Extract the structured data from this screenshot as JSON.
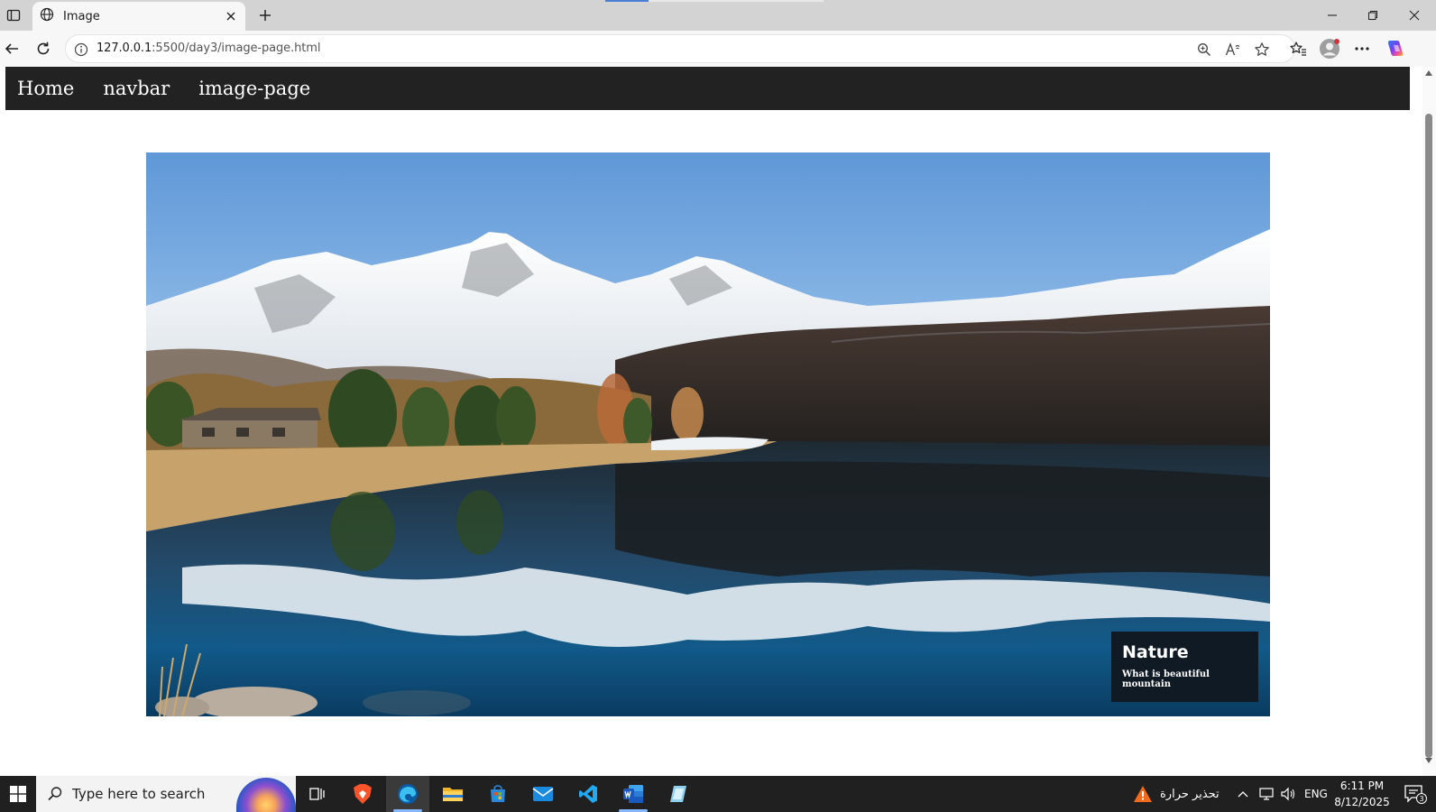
{
  "browser": {
    "tab_title": "Image",
    "url_host": "127.0.0.1",
    "url_path": ":5500/day3/image-page.html"
  },
  "site_nav": {
    "links": [
      "Home",
      "navbar",
      "image-page"
    ]
  },
  "hero": {
    "caption_title": "Nature",
    "caption_subtitle": "What is beautiful mountain"
  },
  "taskbar": {
    "search_placeholder": "Type here to search",
    "weather_text": "تحذير حرارة",
    "language": "ENG",
    "time": "6:11 PM",
    "date": "8/12/2025",
    "notification_count": "3"
  },
  "icons": {
    "tab": "globe-icon",
    "new_tab": "plus-icon",
    "back": "back-arrow-icon",
    "reload": "reload-icon",
    "site_info": "info-icon",
    "zoom": "zoom-icon",
    "read_aloud": "read-aloud-icon",
    "favorite": "star-icon",
    "favorites_bar": "favorites-icon",
    "profile": "profile-icon",
    "more": "more-icon",
    "copilot": "copilot-icon"
  },
  "colors": {
    "site_nav_bg": "#222222",
    "caption_bg": "#0f1a24",
    "taskbar_bg": "#202020"
  }
}
